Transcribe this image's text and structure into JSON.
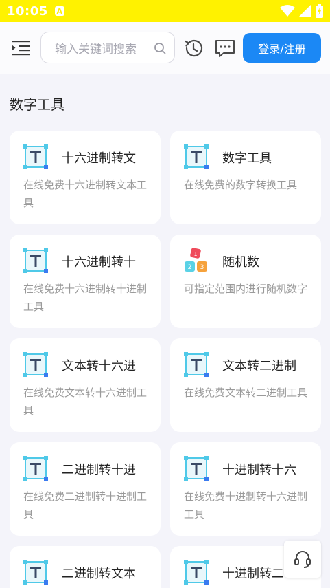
{
  "status_bar": {
    "time": "10:05",
    "notification_letter": "A"
  },
  "header": {
    "search_placeholder": "输入关键词搜索",
    "login_label": "登录/注册"
  },
  "section": {
    "title": "数字工具"
  },
  "cards": [
    {
      "title": "十六进制转文",
      "desc": "在线免费十六进制转文本工具",
      "icon": "t-text-icon"
    },
    {
      "title": "数字工具",
      "desc": "在线免费的数字转换工具",
      "icon": "t-text-icon"
    },
    {
      "title": "十六进制转十",
      "desc": "在线免费十六进制转十进制工具",
      "icon": "t-text-icon"
    },
    {
      "title": "随机数",
      "desc": "可指定范围内进行随机数字",
      "icon": "dice-blocks-icon"
    },
    {
      "title": "文本转十六进",
      "desc": "在线免费文本转十六进制工具",
      "icon": "t-text-icon"
    },
    {
      "title": "文本转二进制",
      "desc": "在线免费文本转二进制工具",
      "icon": "t-text-icon"
    },
    {
      "title": "二进制转十进",
      "desc": "在线免费二进制转十进制工具",
      "icon": "t-text-icon"
    },
    {
      "title": "十进制转十六",
      "desc": "在线免费十进制转十六进制工具",
      "icon": "t-text-icon"
    },
    {
      "title": "二进制转文本",
      "desc": "",
      "icon": "t-text-icon"
    },
    {
      "title": "十进制转二",
      "desc": "",
      "icon": "t-text-icon"
    }
  ],
  "colors": {
    "status_bar": "#fff200",
    "accent": "#1b88f5",
    "background": "#f4f4fa"
  }
}
